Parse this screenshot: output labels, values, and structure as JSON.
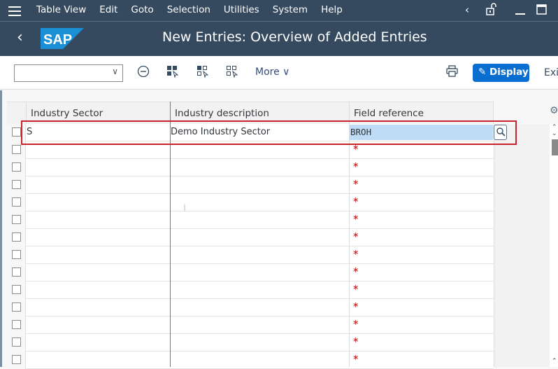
{
  "menubar": {
    "items": [
      "Table View",
      "Edit",
      "Goto",
      "Selection",
      "Utilities",
      "System",
      "Help"
    ],
    "icons": [
      "menu-icon",
      "back-nav-icon",
      "unlock-icon",
      "minimize-icon",
      "maximize-icon"
    ]
  },
  "header": {
    "logo_text": "SAP",
    "title": "New Entries: Overview of Added Entries"
  },
  "toolbar": {
    "command_field_value": "",
    "more_label": "More",
    "display_label": "Display",
    "exit_label": "Exit",
    "icons": [
      "delete-icon",
      "select-all-icon",
      "select-block-icon",
      "deselect-all-icon",
      "print-icon",
      "display-change-icon"
    ]
  },
  "table": {
    "columns": [
      "Industry Sector",
      "Industry description",
      "Field reference"
    ],
    "rows": [
      {
        "industry_sector": "S",
        "industry_description": "Demo Industry Sector",
        "field_reference": "BROH"
      },
      {
        "industry_sector": "",
        "industry_description": "",
        "field_reference": ""
      },
      {
        "industry_sector": "",
        "industry_description": "",
        "field_reference": ""
      },
      {
        "industry_sector": "",
        "industry_description": "",
        "field_reference": ""
      },
      {
        "industry_sector": "",
        "industry_description": "",
        "field_reference": ""
      },
      {
        "industry_sector": "",
        "industry_description": "",
        "field_reference": ""
      },
      {
        "industry_sector": "",
        "industry_description": "",
        "field_reference": ""
      },
      {
        "industry_sector": "",
        "industry_description": "",
        "field_reference": ""
      },
      {
        "industry_sector": "",
        "industry_description": "",
        "field_reference": ""
      },
      {
        "industry_sector": "",
        "industry_description": "",
        "field_reference": ""
      },
      {
        "industry_sector": "",
        "industry_description": "",
        "field_reference": ""
      },
      {
        "industry_sector": "",
        "industry_description": "",
        "field_reference": ""
      },
      {
        "industry_sector": "",
        "industry_description": "",
        "field_reference": ""
      },
      {
        "industry_sector": "",
        "industry_description": "",
        "field_reference": ""
      }
    ],
    "required_marker": "*"
  },
  "colors": {
    "shell": "#354a5f",
    "accent": "#0a6ed1",
    "highlight_box": "#c8242c",
    "required": "#bb0000",
    "selected_input": "#bfdcf6"
  }
}
